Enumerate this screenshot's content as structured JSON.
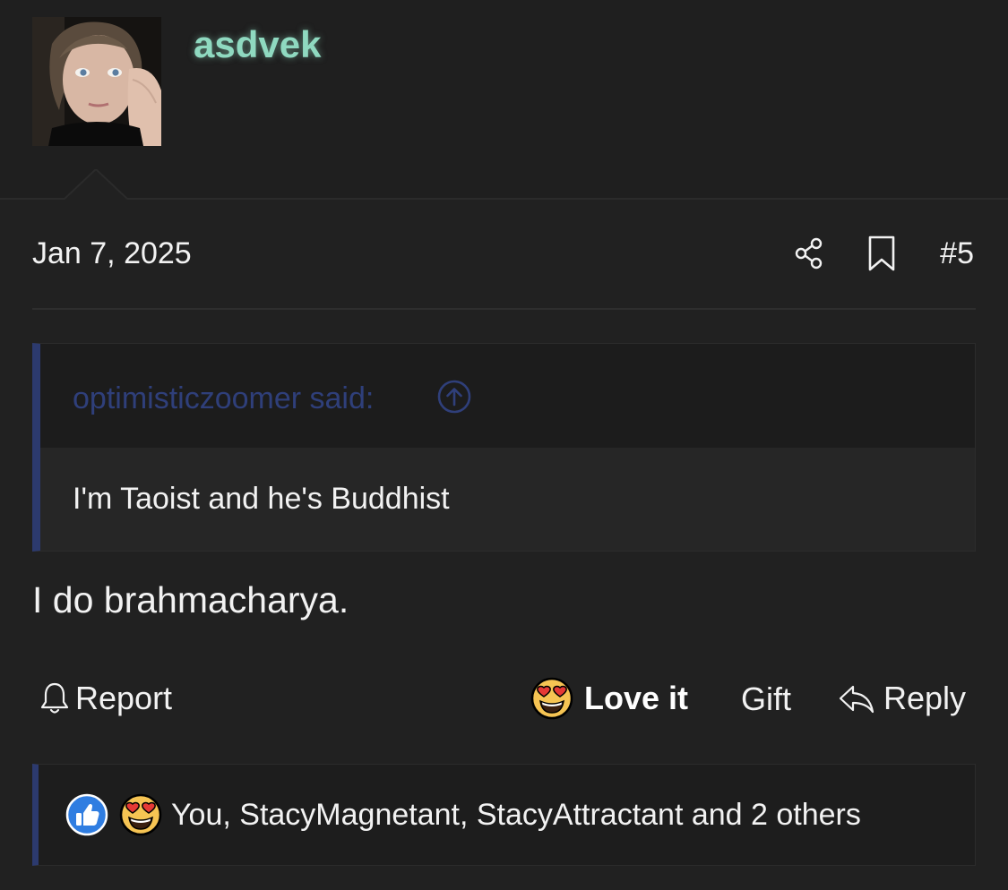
{
  "author": {
    "username": "asdvek",
    "username_color": "#8fd9c0"
  },
  "post": {
    "date": "Jan 7, 2025",
    "number": "#5",
    "body": "I do brahmacharya."
  },
  "quote": {
    "attribution": "optimisticzoomer said:",
    "text": "I'm Taoist and he's Buddhist",
    "accent_color": "#2c3a6e"
  },
  "actions": {
    "report": "Report",
    "love": "Love it",
    "gift": "Gift",
    "reply": "Reply"
  },
  "reactions": {
    "summary": "You, StacyMagnetant, StacyAttractant and 2 others",
    "icons": [
      "thumbs-up-icon",
      "heart-eyes-emoji-icon"
    ]
  },
  "icons": {
    "share": "share-icon",
    "bookmark": "bookmark-icon",
    "quote_jump": "arrow-up-circle-icon",
    "report": "bell-icon",
    "reply": "reply-arrow-icon"
  }
}
